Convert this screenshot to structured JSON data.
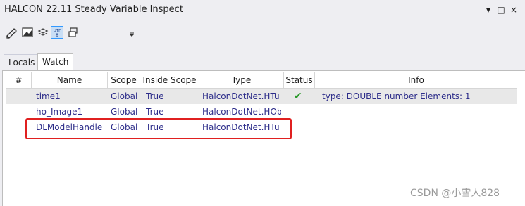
{
  "window": {
    "title": "HALCON 22.11 Steady Variable Inspect",
    "controls": [
      "▾",
      "□",
      "×"
    ]
  },
  "toolbar": {
    "icons": [
      "pencil-ruler-icon",
      "image-icon",
      "layers-icon",
      "utf8-icon",
      "window-icon",
      "dropdown-icon"
    ],
    "utf_label": "UTF 8"
  },
  "tabs": [
    {
      "label": "Locals",
      "active": false
    },
    {
      "label": "Watch",
      "active": true
    }
  ],
  "table": {
    "columns": [
      "#",
      "Name",
      "Scope",
      "Inside Scope",
      "Type",
      "Status",
      "Info"
    ],
    "rows": [
      {
        "num": "",
        "name": "time1",
        "scope": "Global",
        "inside": "True",
        "type": "HalconDotNet.HTu",
        "status": "✔",
        "info": "type: DOUBLE number Elements: 1",
        "selected": true
      },
      {
        "num": "",
        "name": "ho_Image1",
        "scope": "Global",
        "inside": "True",
        "type": "HalconDotNet.HOb",
        "status": "",
        "info": "",
        "selected": false
      },
      {
        "num": "",
        "name": "DLModelHandle",
        "scope": "Global",
        "inside": "True",
        "type": "HalconDotNet.HTu",
        "status": "",
        "info": "",
        "selected": false
      }
    ]
  },
  "annotation": {
    "color": "#e02020"
  },
  "watermark": "CSDN @小雪人828"
}
